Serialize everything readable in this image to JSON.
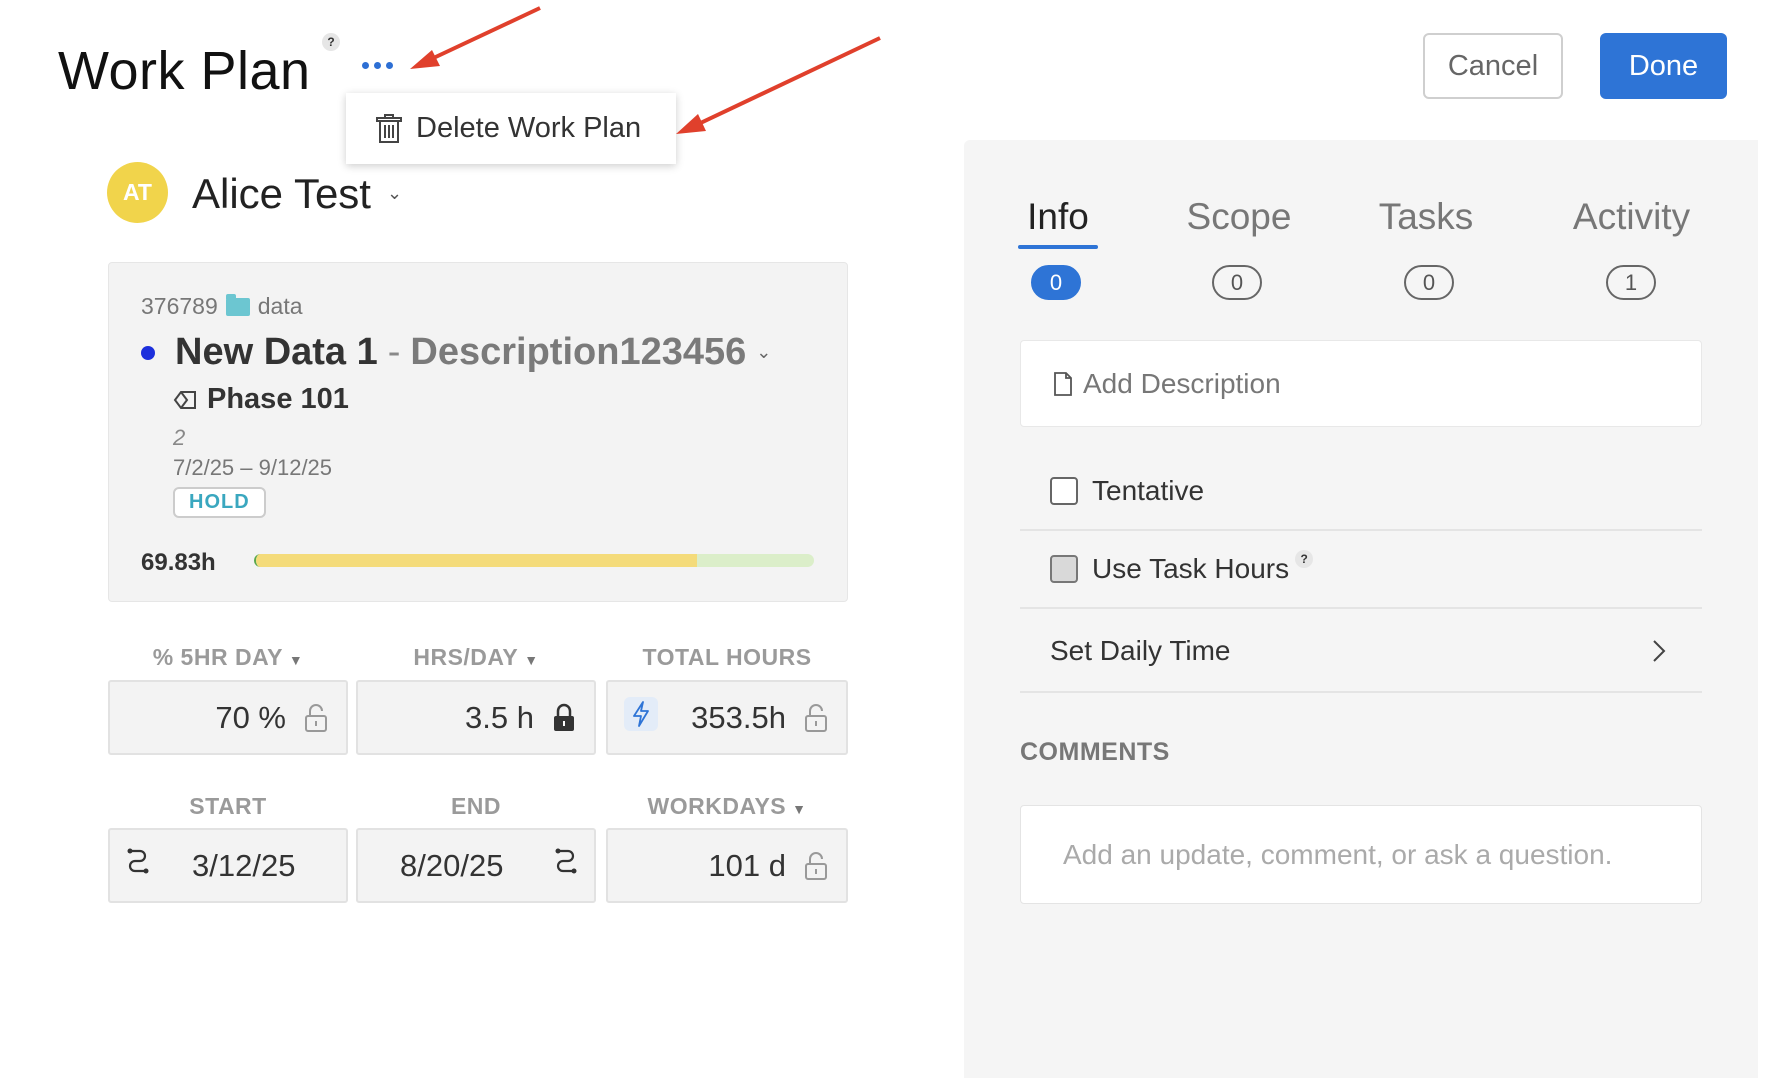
{
  "header": {
    "title": "Work Plan",
    "help": "?",
    "cancel_label": "Cancel",
    "done_label": "Done"
  },
  "menu": {
    "delete_label": "Delete Work Plan"
  },
  "member": {
    "initials": "AT",
    "name": "Alice Test"
  },
  "project": {
    "number": "376789",
    "folder": "data",
    "name": "New Data 1",
    "separator": "-",
    "description": "Description123456",
    "phase": "Phase 101",
    "phase_number": "2",
    "dates": "7/2/25 – 9/12/25",
    "status_badge": "HOLD",
    "hours": "69.83h",
    "progress_fraction": 0.79
  },
  "fields": {
    "pct_label": "% 5HR DAY",
    "pct_value": "70 %",
    "hrs_label": "HRS/DAY",
    "hrs_value": "3.5 h",
    "total_label": "TOTAL HOURS",
    "total_value": "353.5h",
    "start_label": "START",
    "start_value": "3/12/25",
    "end_label": "END",
    "end_value": "8/20/25",
    "workdays_label": "WORKDAYS",
    "workdays_value": "101 d"
  },
  "panel": {
    "tabs": [
      {
        "label": "Info",
        "count": "0"
      },
      {
        "label": "Scope",
        "count": "0"
      },
      {
        "label": "Tasks",
        "count": "0"
      },
      {
        "label": "Activity",
        "count": "1"
      }
    ],
    "description_placeholder": "Add Description",
    "tentative_label": "Tentative",
    "task_hours_label": "Use Task Hours",
    "help": "?",
    "daily_time_label": "Set Daily Time",
    "comments_heading": "COMMENTS",
    "comment_placeholder": "Add an update, comment, or ask a question."
  },
  "colors": {
    "accent": "#2e74d6",
    "avatar": "#f1d44b",
    "project_dot": "#1c2fdc",
    "annotation_arrow": "#e0402c",
    "progress_fill": "#f4db7a",
    "progress_track": "#dbeec9"
  }
}
